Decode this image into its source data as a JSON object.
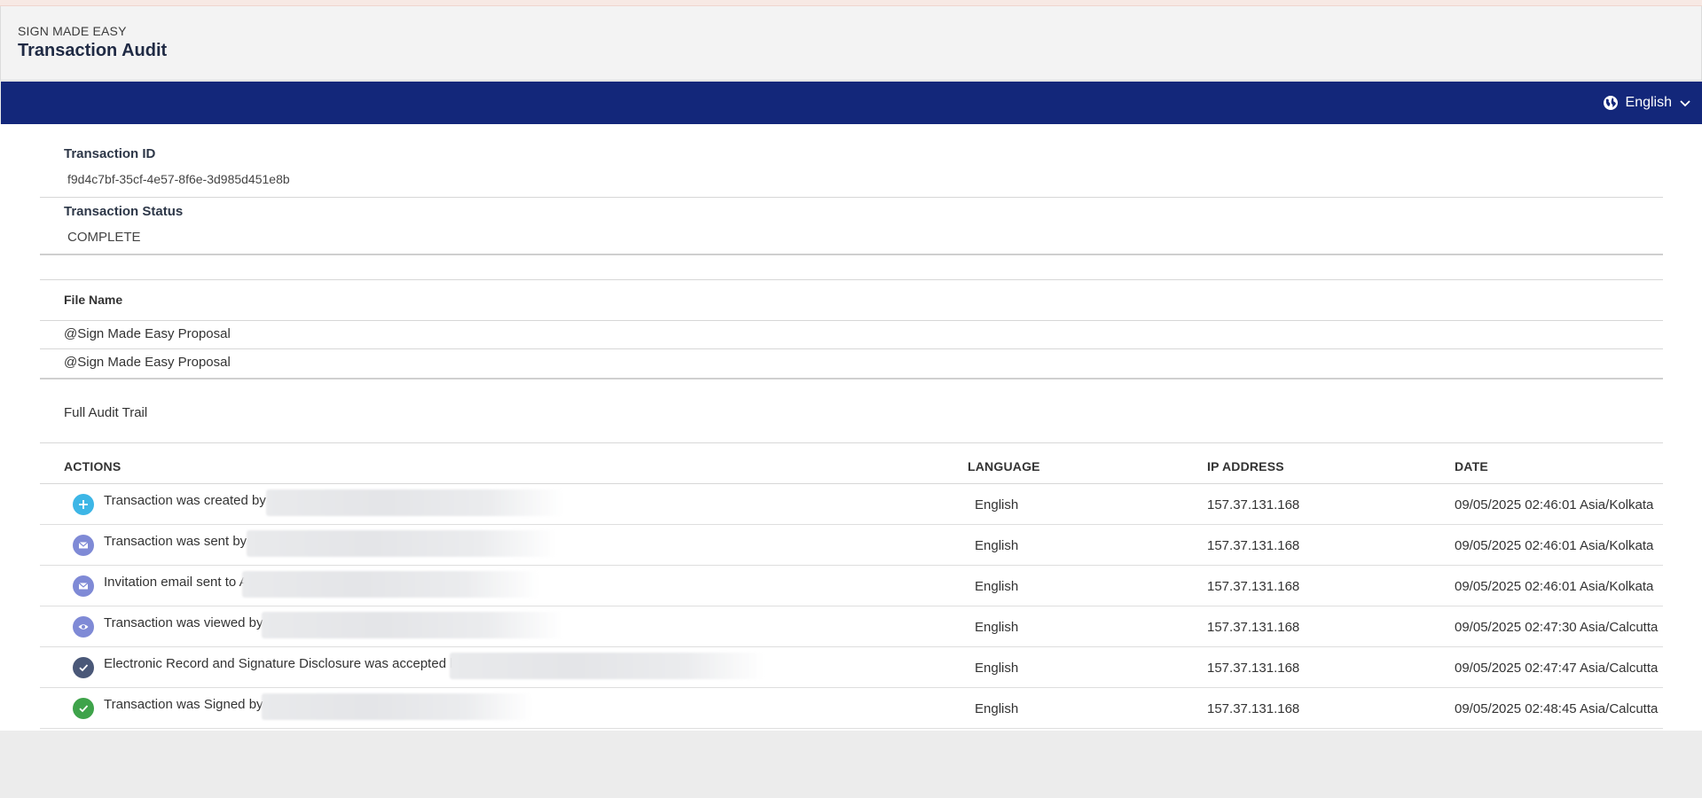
{
  "header": {
    "brand": "SIGN MADE EASY",
    "title": "Transaction Audit"
  },
  "toolbar": {
    "language": "English",
    "globe_icon": "globe-icon",
    "chevron_icon": "chevron-down-icon",
    "bar_color": "#13277a"
  },
  "transaction": {
    "id_label": "Transaction ID",
    "id_value": "f9d4c7bf-35cf-4e57-8f6e-3d985d451e8b",
    "status_label": "Transaction Status",
    "status_value": "COMPLETE"
  },
  "files": {
    "label": "File Name",
    "items": [
      "@Sign Made Easy Proposal",
      "@Sign Made Easy Proposal"
    ]
  },
  "audit": {
    "title": "Full Audit Trail",
    "columns": [
      "ACTIONS",
      "LANGUAGE",
      "IP ADDRESS",
      "DATE"
    ],
    "rows": [
      {
        "icon": "plus-icon",
        "icon_color": "#3db6e6",
        "action": "Transaction was created by A",
        "language": "English",
        "ip": "157.37.131.168",
        "date": "09/05/2025 02:46:01 Asia/Kolkata"
      },
      {
        "icon": "envelope-icon",
        "icon_color": "#7f8ad6",
        "action": "Transaction was sent by A",
        "language": "English",
        "ip": "157.37.131.168",
        "date": "09/05/2025 02:46:01 Asia/Kolkata"
      },
      {
        "icon": "envelope-icon",
        "icon_color": "#7f8ad6",
        "action": "Invitation email sent to A",
        "language": "English",
        "ip": "157.37.131.168",
        "date": "09/05/2025 02:46:01 Asia/Kolkata"
      },
      {
        "icon": "eye-icon",
        "icon_color": "#7f8ad6",
        "action": "Transaction was viewed by",
        "language": "English",
        "ip": "157.37.131.168",
        "date": "09/05/2025 02:47:30 Asia/Calcutta"
      },
      {
        "icon": "check-icon",
        "icon_color": "#4a5878",
        "action": "Electronic Record and Signature Disclosure was accepted b",
        "language": "English",
        "ip": "157.37.131.168",
        "date": "09/05/2025 02:47:47 Asia/Calcutta"
      },
      {
        "icon": "check-icon",
        "icon_color": "#3ea34a",
        "action": "Transaction was Signed by",
        "language": "English",
        "ip": "157.37.131.168",
        "date": "09/05/2025 02:48:45 Asia/Calcutta"
      }
    ]
  }
}
